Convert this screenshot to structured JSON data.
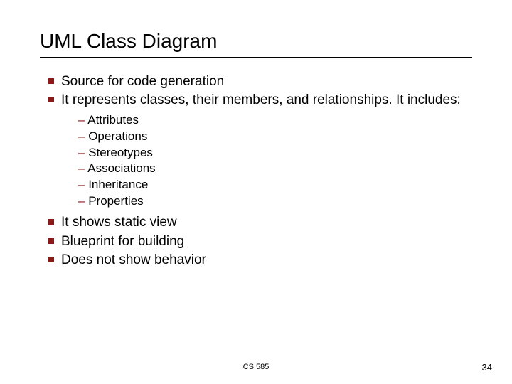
{
  "title": "UML Class Diagram",
  "bullets": [
    {
      "text": "Source for code generation"
    },
    {
      "text": "It represents classes, their members, and relationships.  It includes:",
      "sub": [
        "Attributes",
        "Operations",
        "Stereotypes",
        "Associations",
        "Inheritance",
        "Properties"
      ]
    },
    {
      "text": "It shows static view"
    },
    {
      "text": "Blueprint for building"
    },
    {
      "text": "Does not show behavior"
    }
  ],
  "footer": {
    "course": "CS 585",
    "page": "34"
  }
}
